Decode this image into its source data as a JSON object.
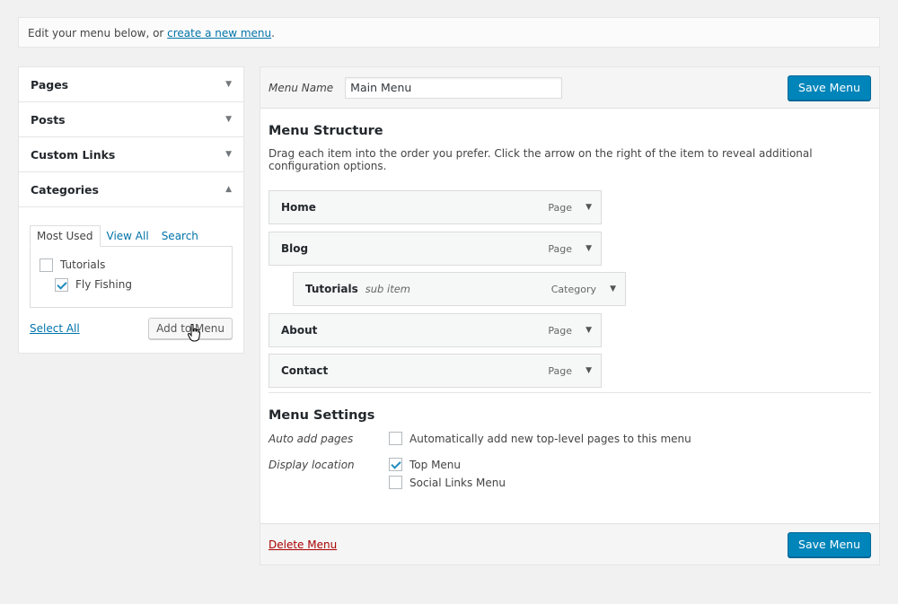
{
  "notice": {
    "text": "Edit your menu below, or ",
    "link": "create a new menu",
    "suffix": "."
  },
  "sidebar": {
    "sections": [
      {
        "label": "Pages",
        "expanded": false
      },
      {
        "label": "Posts",
        "expanded": false
      },
      {
        "label": "Custom Links",
        "expanded": false
      },
      {
        "label": "Categories",
        "expanded": true
      }
    ],
    "categories": {
      "tabs": [
        "Most Used",
        "View All",
        "Search"
      ],
      "items": [
        {
          "label": "Tutorials",
          "checked": false
        },
        {
          "label": "Fly Fishing",
          "checked": true
        }
      ],
      "select_all": "Select All",
      "add_button": "Add to Menu"
    }
  },
  "menu": {
    "name_label": "Menu Name",
    "name_value": "Main Menu",
    "save_label": "Save Menu",
    "structure_title": "Menu Structure",
    "structure_hint": "Drag each item into the order you prefer. Click the arrow on the right of the item to reveal additional configuration options.",
    "items": [
      {
        "title": "Home",
        "sub": "",
        "type": "Page"
      },
      {
        "title": "Blog",
        "sub": "",
        "type": "Page"
      },
      {
        "title": "Tutorials",
        "sub": "sub item",
        "type": "Category"
      },
      {
        "title": "About",
        "sub": "",
        "type": "Page"
      },
      {
        "title": "Contact",
        "sub": "",
        "type": "Page"
      }
    ],
    "settings_title": "Menu Settings",
    "auto_add_label": "Auto add pages",
    "auto_add_option": "Automatically add new top-level pages to this menu",
    "display_location_label": "Display location",
    "locations": [
      {
        "label": "Top Menu",
        "checked": true
      },
      {
        "label": "Social Links Menu",
        "checked": false
      }
    ],
    "delete_label": "Delete Menu"
  },
  "colors": {
    "primary": "#0085ba",
    "link": "#0073aa",
    "delete": "#aa0000"
  }
}
